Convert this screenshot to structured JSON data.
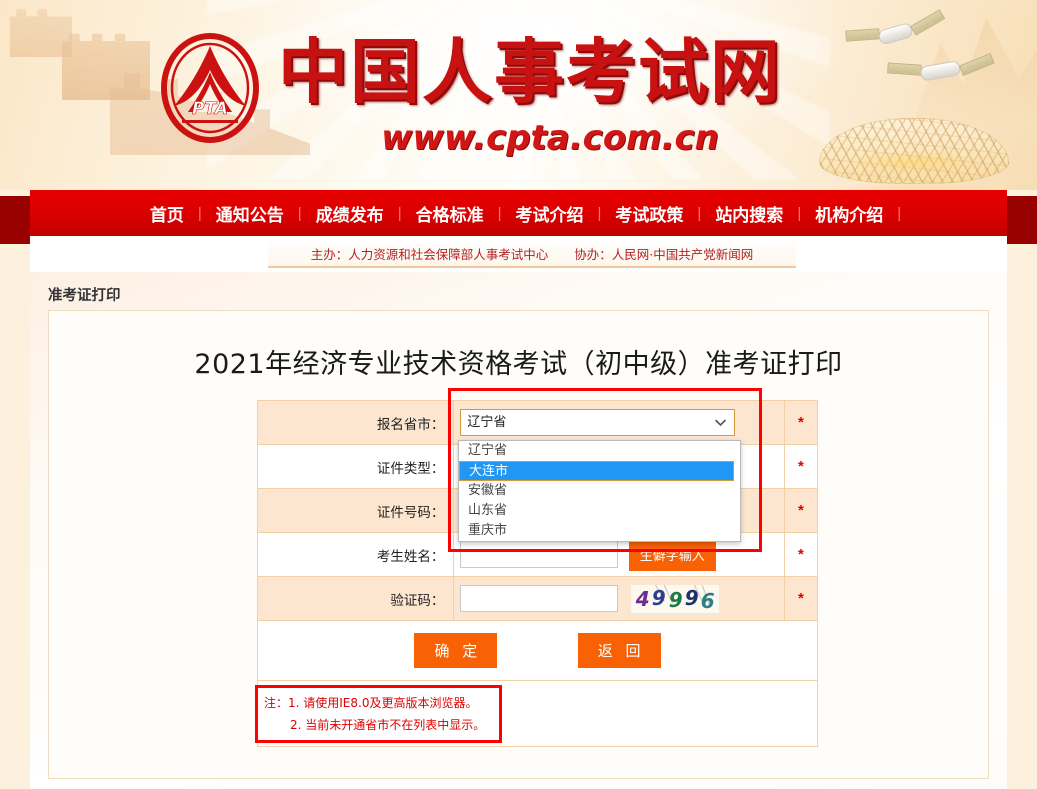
{
  "banner": {
    "site_title": "中国人事考试网",
    "site_url": "www.cpta.com.cn",
    "logo_text": "PTA"
  },
  "nav": {
    "items": [
      "首页",
      "通知公告",
      "成绩发布",
      "合格标准",
      "考试介绍",
      "考试政策",
      "站内搜索",
      "机构介绍"
    ]
  },
  "subheader": {
    "organizer": "主办：人力资源和社会保障部人事考试中心",
    "coorganizer": "协办：人民网·中国共产党新闻网"
  },
  "breadcrumb": "准考证打印",
  "page_title": "2021年经济专业技术资格考试（初中级）准考证打印",
  "form": {
    "rows": [
      {
        "label": "报名省市：",
        "type": "select",
        "value": "辽宁省",
        "required": "*"
      },
      {
        "label": "证件类型：",
        "type": "select",
        "value": "",
        "required": "*"
      },
      {
        "label": "证件号码：",
        "type": "text",
        "value": "",
        "required": "*"
      },
      {
        "label": "考生姓名：",
        "type": "text_with_button",
        "value": "",
        "button": "生僻字输入",
        "required": "*"
      },
      {
        "label": "验证码：",
        "type": "captcha",
        "value": "",
        "required": "*"
      }
    ],
    "province_options": [
      "辽宁省",
      "大连市",
      "安徽省",
      "山东省",
      "重庆市"
    ],
    "province_selected_index": 1,
    "captcha_text": "49996",
    "captcha_digits": [
      {
        "ch": "4",
        "color": "#6b2d91"
      },
      {
        "ch": "9",
        "color": "#2c3e8f"
      },
      {
        "ch": "9",
        "color": "#1b7a4a"
      },
      {
        "ch": "9",
        "color": "#1c2f6e"
      },
      {
        "ch": "6",
        "color": "#2b7f82"
      }
    ],
    "submit_label": "确 定",
    "back_label": "返 回"
  },
  "notes": {
    "note1": "注：1. 请使用IE8.0及更高版本浏览器。",
    "note2": "2. 当前未开通省市不在列表中显示。"
  },
  "colors": {
    "brand_red": "#d21616",
    "nav_red": "#dd0000",
    "accent_orange": "#f96105",
    "row_peach": "#fce6d0",
    "annotation_red": "#ff0000",
    "highlight_blue": "#2196f3"
  }
}
